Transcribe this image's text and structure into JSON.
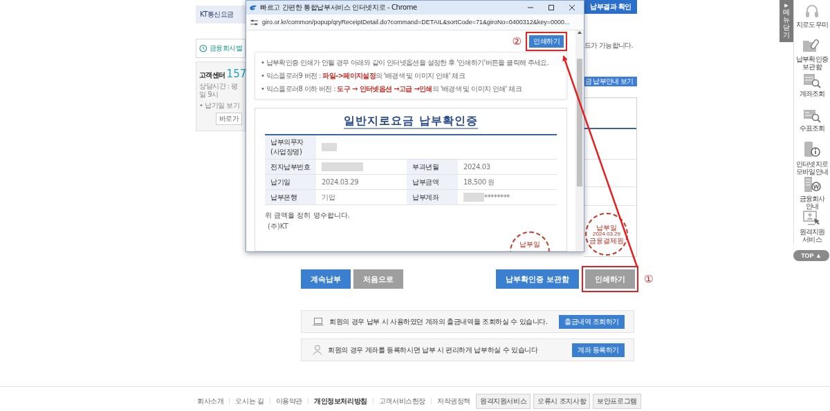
{
  "left_panel": {
    "tab": "KT통신요금",
    "notice": "금융회사별",
    "center_label": "고객센터",
    "center_phone": "157",
    "hours": "상담시간 : 평일 9시",
    "due_link": "• 납기일 보기",
    "shortcut_button": "바로가"
  },
  "result_tab": "납부결과 확인",
  "notice_fragment": "드가 가능합니다.",
  "guide_bar": "금 납부안내 보기",
  "result_stamp": {
    "top": "납부일",
    "date": "2024.03.29",
    "bottom": "금융결제원"
  },
  "popup": {
    "title": "빠르고 간편한 통합납부서비스 인터넷지로 - Chrome",
    "url": "giro.or.kr/common/popup/qryReceiptDetail.do?command=DETAIL&sortCode=71&giroNo=0400312&key=0000...",
    "print_button": {
      "label": "인쇄하기",
      "highlighted": true,
      "step": "②"
    },
    "notes": [
      "• 납부확인증 인쇄가 안될 경우 아래와 같이 인터넷옵션을 설정한 후 '인쇄하기'버튼을 클릭해 주세요.",
      "• 익스플로러9 버전 : **파일->페이지설정**의 '배경색 및 이미지 인쇄' 체크",
      "• 익스플로러8 이하 버전 : **도구 → 인터넷옵션 →고급 →인쇄**의 '배경색 및 이미지 인쇄' 체크"
    ],
    "certificate": {
      "title": "일반지로요금 납부확인증",
      "rows": [
        [
          {
            "label": "납부의무자 (사업장명)",
            "redacted": true
          }
        ],
        [
          {
            "label": "전자납부번호",
            "redacted": true
          },
          {
            "label": "부과년월",
            "value": "2024.03",
            "redacted": false
          }
        ],
        [
          {
            "label": "납기일",
            "value": "2024.03.29",
            "redacted": false
          },
          {
            "label": "납부금액",
            "value": "18,500 원",
            "redacted": false
          }
        ],
        [
          {
            "label": "납부은행",
            "value": "기업",
            "redacted": false
          },
          {
            "label": "납부계좌",
            "value": "********",
            "redacted": true
          }
        ]
      ],
      "receipt_text": "위 금액을 정히 영수합니다.",
      "issuer": "(주)KT",
      "stamp": "납부일"
    }
  },
  "actions": {
    "left": [
      {
        "label": "계속납부",
        "kind": "primary",
        "highlighted": false
      },
      {
        "label": "처음으로",
        "kind": "secondary",
        "highlighted": false
      }
    ],
    "right": [
      {
        "label": "납부확인증 보관함",
        "kind": "primary",
        "highlighted": false
      },
      {
        "label": "인쇄하기",
        "kind": "secondary",
        "highlighted": true,
        "step": "①"
      }
    ]
  },
  "info_rows": [
    {
      "kind": "laptop",
      "text": "회원의 경우 납부 시 사용하였던 계좌의 출금내역을 조회하실 수 있습니다.",
      "button": "출금내역 조회하기"
    },
    {
      "kind": "person",
      "text": "회원의 경우 계좌를 등록하시면 납부 시 편리하게 납부하실 수 있습니다",
      "button": "계좌 등록하기"
    }
  ],
  "footer": {
    "links": [
      {
        "label": "회사소개",
        "bold": false
      },
      {
        "label": "오시는 길",
        "bold": false
      },
      {
        "label": "이용약관",
        "bold": false
      },
      {
        "label": "개인정보처리방침",
        "bold": true
      },
      {
        "label": "고객서비스헌장",
        "bold": false
      },
      {
        "label": "저작권정책",
        "bold": false
      }
    ],
    "buttons": [
      "원격지원서비스",
      "오류시 조치사항",
      "보안프로그램"
    ]
  },
  "quick_menu": {
    "toggle_arrow": "▶",
    "toggle_label": "메뉴닫기",
    "items": [
      {
        "kind": "headset",
        "label": "지로도우미"
      },
      {
        "kind": "folder",
        "label": "납부확인증 보관함"
      },
      {
        "kind": "list-search",
        "label": "계좌조회"
      },
      {
        "kind": "cheque-search",
        "label": "수표조회"
      },
      {
        "kind": "phone-info",
        "label": "인터넷지로 모바일안내"
      },
      {
        "kind": "building-won",
        "label": "금융회사 안내"
      },
      {
        "kind": "monitor-person",
        "label": "원격지원 서비스"
      }
    ],
    "top_button": "TOP ▲"
  }
}
